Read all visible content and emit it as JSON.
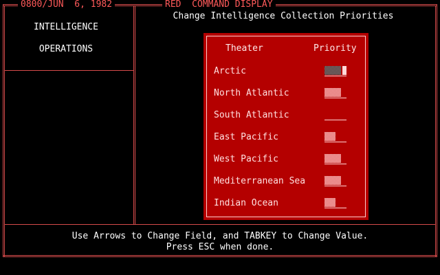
{
  "header": {
    "datetime": "0800/JUN  6, 1982",
    "mode": "RED  COMMAND DISPLAY"
  },
  "title": "Change Intelligence Collection Priorities",
  "sidebar": {
    "items": [
      {
        "label": "INTELLIGENCE"
      },
      {
        "label": "OPERATIONS"
      }
    ]
  },
  "panel": {
    "col_theater": "Theater",
    "col_priority": "Priority",
    "rows": [
      {
        "theater": "Arctic",
        "priority_fraction": 0.75,
        "selected": true
      },
      {
        "theater": "North Atlantic",
        "priority_fraction": 0.75,
        "selected": false
      },
      {
        "theater": "South Atlantic",
        "priority_fraction": 0.0,
        "selected": false
      },
      {
        "theater": "East Pacific",
        "priority_fraction": 0.5,
        "selected": false
      },
      {
        "theater": "West Pacific",
        "priority_fraction": 0.75,
        "selected": false
      },
      {
        "theater": "Mediterranean Sea",
        "priority_fraction": 0.75,
        "selected": false
      },
      {
        "theater": "Indian Ocean",
        "priority_fraction": 0.5,
        "selected": false
      }
    ]
  },
  "footer": {
    "line1": "Use Arrows to Change Field, and TABKEY to Change Value.",
    "line2": "Press ESC when done."
  },
  "colors": {
    "frame": "#d64b4b",
    "header_text": "#ff5a5a",
    "panel_bg": "#b40000",
    "background": "#000000"
  }
}
